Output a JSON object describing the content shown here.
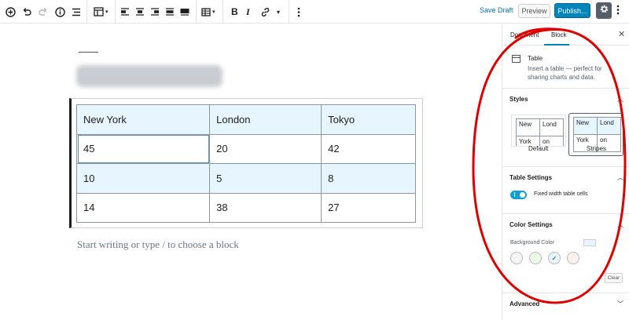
{
  "toolbar": {
    "save_draft": "Save Draft",
    "preview": "Preview",
    "publish": "Publish...",
    "bold": "B",
    "italic": "I",
    "icons": [
      "add-block-icon",
      "undo-icon",
      "redo-icon",
      "info-icon",
      "list-view-icon",
      "table-icon",
      "align-left-icon",
      "align-center-icon",
      "align-right-icon",
      "align-wide-icon",
      "align-full-icon",
      "edit-table-icon",
      "link-icon",
      "more-options-icon",
      "gear-icon",
      "kebab-icon"
    ]
  },
  "editor": {
    "placeholder": "Start writing or type / to choose a block",
    "table": {
      "rows": [
        [
          "New York",
          "London",
          "Tokyo"
        ],
        [
          "45",
          "20",
          "42"
        ],
        [
          "10",
          "5",
          "8"
        ],
        [
          "14",
          "38",
          "27"
        ]
      ]
    }
  },
  "sidebar": {
    "tabs": [
      "Document",
      "Block"
    ],
    "active_tab": "Block",
    "block": {
      "name": "Table",
      "description": "Insert a table — perfect for sharing charts and data."
    },
    "styles": {
      "title": "Styles",
      "options": [
        {
          "label": "Default",
          "cells": [
            "New",
            "Lond"
          ],
          "lower": [
            "York",
            "on"
          ]
        },
        {
          "label": "Stripes",
          "cells": [
            "New",
            "Lond"
          ],
          "lower": [
            "York",
            "on"
          ]
        }
      ],
      "selected": "Stripes"
    },
    "table_settings": {
      "title": "Table Settings",
      "fixed_width_label": "Fixed width table cells",
      "fixed_width_enabled": true
    },
    "color_settings": {
      "title": "Color Settings",
      "background_label": "Background Color",
      "swatches": [
        "#f3f4f5",
        "#e9fbe5",
        "#e7f5fe",
        "#fcf0ef"
      ],
      "selected_swatch": 2,
      "clear": "Clear"
    },
    "advanced": {
      "title": "Advanced"
    }
  },
  "colors": {
    "accent": "#0085ba",
    "link": "#0073aa",
    "stripe": "#e7f5fe",
    "annotation": "#e00000"
  }
}
